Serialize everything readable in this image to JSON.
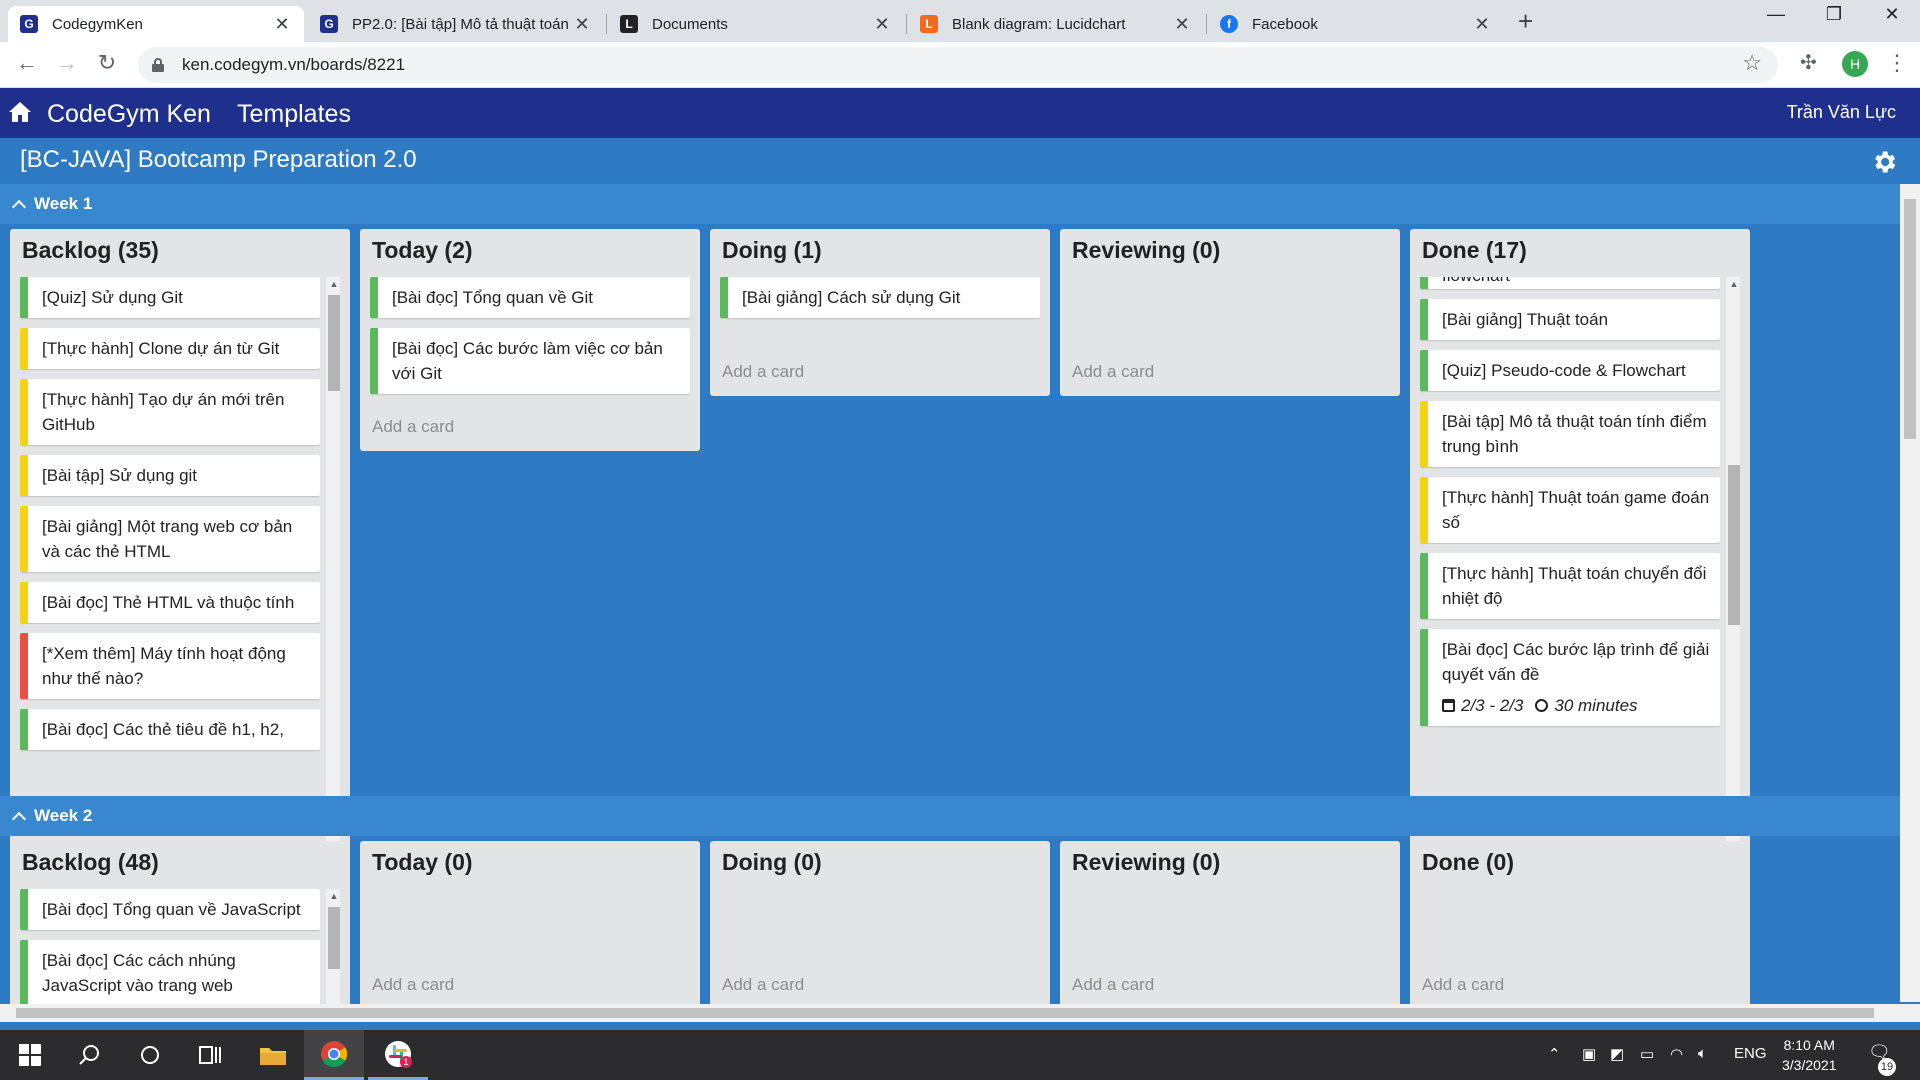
{
  "browser": {
    "tabs": [
      {
        "title": "CodegymKen",
        "favicon": "G",
        "favicon_color": "#1e2f8c",
        "active": true
      },
      {
        "title": "PP2.0: [Bài tập] Mô tả thuật toán",
        "favicon": "G",
        "favicon_color": "#1e2f8c",
        "active": false
      },
      {
        "title": "Documents",
        "favicon": "L",
        "favicon_color": "#222222",
        "active": false
      },
      {
        "title": "Blank diagram: Lucidchart",
        "favicon": "L",
        "favicon_color": "#f26a21",
        "active": false
      },
      {
        "title": "Facebook",
        "favicon": "f",
        "favicon_color": "#1877f2",
        "active": false
      }
    ],
    "url": "ken.codegym.vn/boards/8221",
    "profile_initial": "H"
  },
  "app": {
    "brand": "CodeGym Ken",
    "templates": "Templates",
    "user": "Trần Văn Lực",
    "board_title": "[BC-JAVA] Bootcamp Preparation 2.0",
    "add_card_label": "Add a card"
  },
  "weeks": [
    {
      "title": "Week 1",
      "lists": [
        {
          "title": "Backlog (35)",
          "cards": [
            {
              "text": "[Quiz] Sử dụng Git",
              "color": "green"
            },
            {
              "text": "[Thực hành] Clone dự án từ Git",
              "color": "yellow"
            },
            {
              "text": "[Thực hành] Tạo dự án mới trên GitHub",
              "color": "yellow"
            },
            {
              "text": "[Bài tập] Sử dụng git",
              "color": "yellow"
            },
            {
              "text": "[Bài giảng] Một trang web cơ bản và các thẻ HTML",
              "color": "yellow"
            },
            {
              "text": "[Bài đọc] Thẻ HTML và thuộc tính",
              "color": "yellow"
            },
            {
              "text": "[*Xem thêm] Máy tính hoạt động như thế nào?",
              "color": "red"
            },
            {
              "text": "[Bài đọc] Các thẻ tiêu đề h1, h2,",
              "color": "green"
            }
          ]
        },
        {
          "title": "Today (2)",
          "cards": [
            {
              "text": "[Bài đọc] Tổng quan về Git",
              "color": "green"
            },
            {
              "text": "[Bài đọc] Các bước làm việc cơ bản với Git",
              "color": "green"
            }
          ]
        },
        {
          "title": "Doing (1)",
          "cards": [
            {
              "text": "[Bài giảng] Cách sử dụng Git",
              "color": "green"
            }
          ]
        },
        {
          "title": "Reviewing (0)",
          "cards": []
        },
        {
          "title": "Done (17)",
          "cards": [
            {
              "text": "flowchart",
              "color": "green"
            },
            {
              "text": "[Bài giảng] Thuật toán",
              "color": "green"
            },
            {
              "text": "[Quiz] Pseudo-code & Flowchart",
              "color": "green"
            },
            {
              "text": "[Bài tập] Mô tả thuật toán tính điểm trung bình",
              "color": "yellow"
            },
            {
              "text": "[Thực hành] Thuật toán game đoán số",
              "color": "yellow"
            },
            {
              "text": "[Thực hành] Thuật toán chuyển đổi nhiệt độ",
              "color": "green"
            },
            {
              "text": "[Bài đọc] Các bước lập trình để giải quyết vấn đề",
              "color": "green",
              "date": "2/3 - 2/3",
              "duration": "30 minutes"
            }
          ]
        }
      ]
    },
    {
      "title": "Week 2",
      "lists": [
        {
          "title": "Backlog (48)",
          "cards": [
            {
              "text": "[Bài đọc] Tổng quan về JavaScript",
              "color": "green"
            },
            {
              "text": "[Bài đọc] Các cách nhúng JavaScript vào trang web",
              "color": "green"
            }
          ]
        },
        {
          "title": "Today (0)",
          "cards": []
        },
        {
          "title": "Doing (0)",
          "cards": []
        },
        {
          "title": "Reviewing (0)",
          "cards": []
        },
        {
          "title": "Done (0)",
          "cards": []
        }
      ]
    }
  ],
  "taskbar": {
    "language": "ENG",
    "time": "8:10 AM",
    "date": "3/3/2021",
    "notifications": "19",
    "slack_badge": "1"
  },
  "colors": {
    "nav": "#1e2f8c",
    "board": "#2f7bc3",
    "label_green": "#5cb85c",
    "label_yellow": "#f5d212",
    "label_red": "#e8503f"
  }
}
